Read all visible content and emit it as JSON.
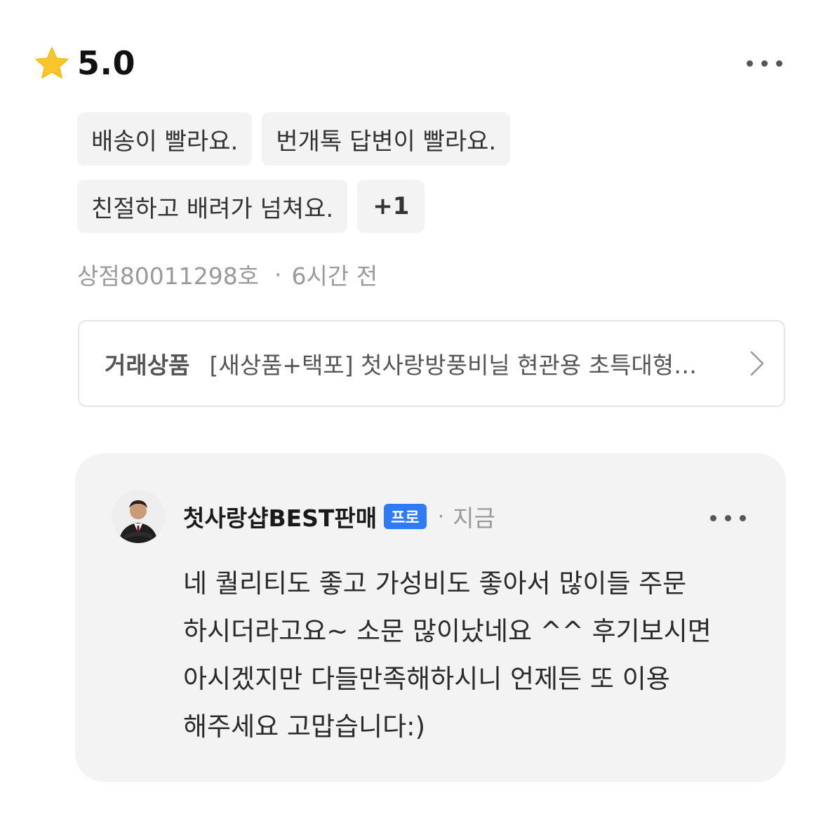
{
  "review": {
    "score": "5.0",
    "tags": [
      "배송이 빨라요.",
      "번개톡 답변이 빨라요.",
      "친절하고 배려가 넘쳐요.",
      "+1"
    ],
    "reviewer": "상점80011298호",
    "separator": "·",
    "time": "6시간 전",
    "product": {
      "label": "거래상품",
      "name": "[새상품+택포] 첫사랑방풍비닐 현관용 초특대형…"
    }
  },
  "reply": {
    "seller_name": "첫사랑샵BEST판매",
    "badge": "프로",
    "separator": "·",
    "time": "지금",
    "text": "네 퀄리티도 좋고 가성비도 좋아서 많이들 주문\n하시더라고요~ 소문 많이났네요 ^^ 후기보시면\n아시겠지만 다들만족해하시니 언제든 또 이용\n해주세요 고맙습니다:)"
  },
  "colors": {
    "star": "#F9C52A",
    "badge": "#2F7AF5",
    "tag_bg": "#F3F3F3",
    "muted_text": "#9A9A9A",
    "card_bg": "#F3F3F3"
  },
  "icons": {
    "rating": "star-icon",
    "more": "more-dots-icon",
    "product_link": "chevron-right-icon",
    "seller": "avatar"
  }
}
